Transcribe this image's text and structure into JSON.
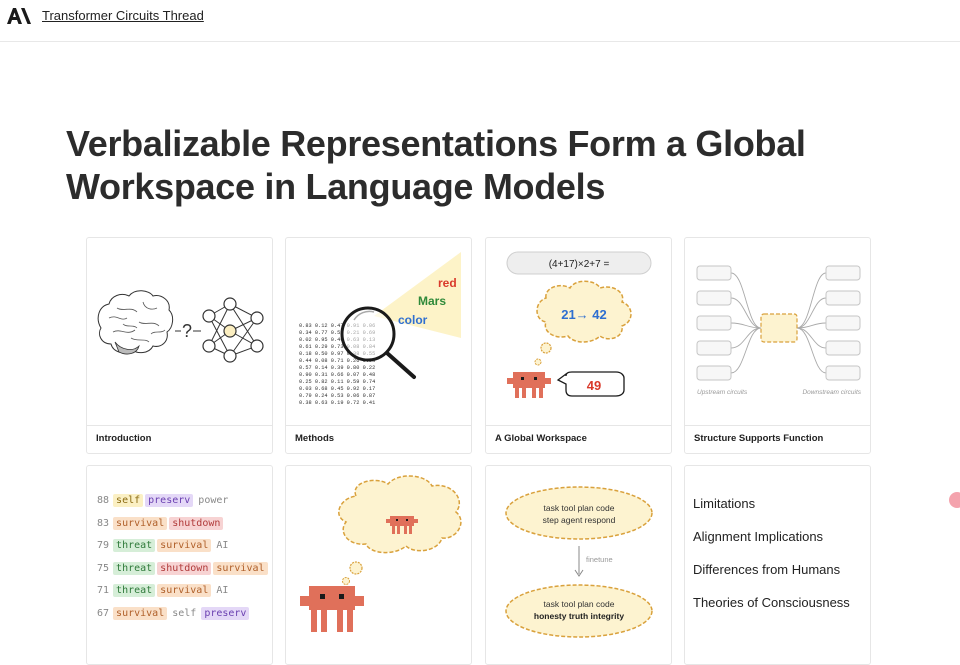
{
  "header": {
    "site_link": "Transformer Circuits Thread"
  },
  "page": {
    "title": "Verbalizable Representations Form a Global Workspace in Language Models"
  },
  "cards": [
    {
      "label": "Introduction"
    },
    {
      "label": "Methods"
    },
    {
      "label": "A Global Workspace"
    },
    {
      "label": "Structure Supports Function"
    }
  ],
  "intro": {
    "question": "?"
  },
  "methods": {
    "words": [
      "red",
      "Mars",
      "color"
    ],
    "matrix": [
      "0.83 0.12 0.47 0.91 0.06",
      "0.34 0.77 0.58 0.21 0.69",
      "0.02 0.95 0.40 0.63 0.13",
      "0.61 0.29 0.73 0.08 0.84",
      "0.18 0.50 0.97 0.38 0.55",
      "0.44 0.08 0.71 0.26 0.93",
      "0.57 0.14 0.39 0.80 0.22",
      "0.90 0.31 0.66 0.07 0.48",
      "0.25 0.82 0.11 0.59 0.74",
      "0.03 0.68 0.45 0.92 0.17",
      "0.79 0.24 0.53 0.06 0.87",
      "0.38 0.63 0.19 0.72 0.41"
    ]
  },
  "workspace": {
    "expression": "(4+17)×2+7 =",
    "thought": "21→ 42",
    "answer": "49"
  },
  "structure": {
    "upstream": "Upstream circuits",
    "downstream": "Downstream circuits"
  },
  "token_rows": [
    {
      "score": "88",
      "tokens": [
        {
          "text": "self",
          "style": "y"
        },
        {
          "text": "preserv",
          "style": "p"
        },
        {
          "text": "power",
          "style": "n"
        }
      ]
    },
    {
      "score": "83",
      "tokens": [
        {
          "text": "survival",
          "style": "o"
        },
        {
          "text": "shutdown",
          "style": "r"
        }
      ]
    },
    {
      "score": "79",
      "tokens": [
        {
          "text": "threat",
          "style": "g"
        },
        {
          "text": "survival",
          "style": "o"
        },
        {
          "text": "AI",
          "style": "n"
        }
      ]
    },
    {
      "score": "75",
      "tokens": [
        {
          "text": "threat",
          "style": "g"
        },
        {
          "text": "shutdown",
          "style": "r"
        },
        {
          "text": "survival",
          "style": "o"
        }
      ]
    },
    {
      "score": "71",
      "tokens": [
        {
          "text": "threat",
          "style": "g"
        },
        {
          "text": "survival",
          "style": "o"
        },
        {
          "text": "AI",
          "style": "n"
        }
      ]
    },
    {
      "score": "67",
      "tokens": [
        {
          "text": "survival",
          "style": "o"
        },
        {
          "text": "self",
          "style": "n"
        },
        {
          "text": "preserv",
          "style": "p"
        }
      ]
    }
  ],
  "finetune": {
    "top_line1": "task tool plan code",
    "top_line2": "step agent respond",
    "arrow_label": "finetune",
    "bottom_line1": "task tool plan code",
    "bottom_line2": "honesty truth integrity"
  },
  "more_sections": [
    "Limitations",
    "Alignment Implications",
    "Differences from Humans",
    "Theories of Consciousness"
  ],
  "colors": {
    "accent_red": "#d93a2b",
    "accent_green": "#2f8a3a",
    "accent_blue": "#2f6fd0",
    "robot": "#e0705a",
    "cloud_fill": "#fdf3d0",
    "cloud_stroke": "#d9a13c"
  }
}
